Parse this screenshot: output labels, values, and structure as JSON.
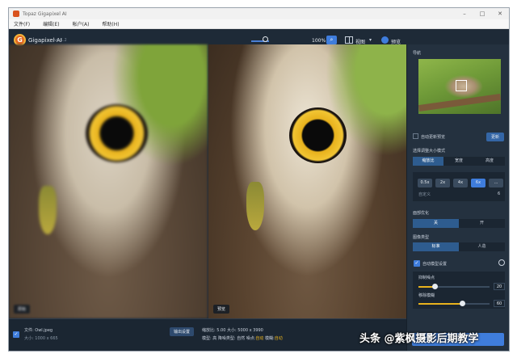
{
  "window": {
    "title": "Topaz Gigapixel AI"
  },
  "menu": {
    "items": [
      "文件(F)",
      "编辑(E)",
      "帐户(A)",
      "帮助(H)"
    ]
  },
  "toolbar": {
    "app_name": "Gigapixel AI",
    "app_version": "v4.1.2",
    "zoom_level": "100%",
    "view_label": "视图",
    "preview_label": "预览"
  },
  "images": {
    "left_label": "原始",
    "right_label": "预览"
  },
  "bottom": {
    "file_name": "文件: Owl.jpeg",
    "file_size": "大小: 1000 x 665",
    "output_button": "输出设置",
    "output_line1": "缩放比: 5.00  大小: 5000 x 3990",
    "output_line2_prefix": "模型: 高  降噪类型: 自然  噪点:",
    "output_line2_v1": "自动",
    "output_line2_mid": " 模糊:",
    "output_line2_v2": "自动"
  },
  "sidebar": {
    "navigator_title": "导航",
    "auto_preview_label": "自动更新预览",
    "auto_preview_btn": "更新",
    "resize_title": "选择调整大小模式",
    "resize_modes": [
      "缩放比",
      "宽度",
      "高度"
    ],
    "scales": [
      "0.5x",
      "2x",
      "4x",
      "6x",
      "..."
    ],
    "scale_custom": "自定义",
    "scale_custom_value": "6",
    "face_title": "面部优化",
    "face_options": [
      "关",
      "开"
    ],
    "model_title": "图像类型",
    "model_options": [
      "标准",
      "人造"
    ],
    "auto_settings_label": "自动模型设置",
    "noise_label": "抑制噪点",
    "noise_value": "20",
    "blur_label": "移除模糊",
    "blur_value": "60",
    "save_btn": "保存"
  },
  "watermark": {
    "text": "头条 @紫枫摄影后期教学"
  }
}
